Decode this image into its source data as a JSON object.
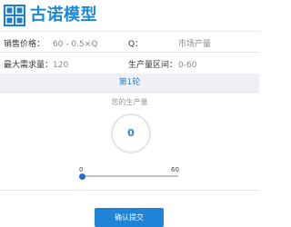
{
  "app": {
    "title": "古诺模型",
    "logo_icon": "grid-window-icon",
    "accent_color": "#1a8ad8"
  },
  "info": {
    "price_label": "销售价格：",
    "price_value": "60 - 0.5×Q",
    "q_label": "Q：",
    "q_value": "市场产量",
    "max_demand_label": "最大需求量：",
    "max_demand_value": "120",
    "range_label": "生产量区间：",
    "range_value": "0-60"
  },
  "round": {
    "label": "第1轮"
  },
  "production": {
    "label": "您的生产量",
    "value": "0"
  },
  "slider": {
    "min_label": "0",
    "max_label": "60",
    "value": 0,
    "min": 0,
    "max": 60
  },
  "submit": {
    "label": "确认提交"
  }
}
